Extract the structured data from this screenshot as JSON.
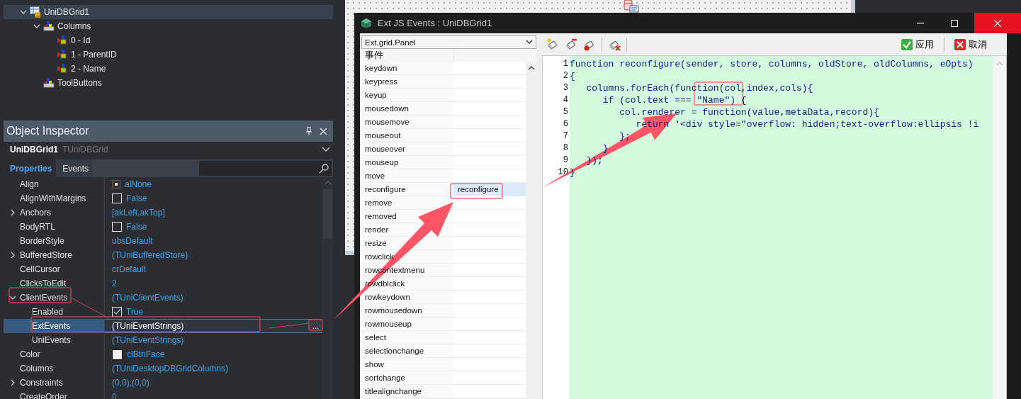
{
  "tree": [
    {
      "label": "UniDBGrid1",
      "kind": "grid",
      "selected": true,
      "expanded": true,
      "children": [
        {
          "label": "Columns",
          "kind": "collection",
          "selected": false,
          "expanded": true,
          "children": [
            {
              "label": "0 - Id",
              "kind": "column",
              "selected": false
            },
            {
              "label": "1 - ParentID",
              "kind": "column",
              "selected": false
            },
            {
              "label": "2 - Name",
              "kind": "column",
              "selected": false
            }
          ]
        },
        {
          "label": "ToolButtons",
          "kind": "collection",
          "selected": false
        }
      ]
    }
  ],
  "inspector": {
    "title": "Object Inspector",
    "component": {
      "name": "UniDBGrid1",
      "type": "TUniDBGrid"
    },
    "tabs": [
      {
        "label": "Properties",
        "selected": true
      },
      {
        "label": "Events",
        "selected": false
      }
    ],
    "properties": [
      {
        "name": "Align",
        "value": "alNone",
        "kind": "align",
        "selected": false
      },
      {
        "name": "AlignWithMargins",
        "value": "False",
        "kind": "checkbox",
        "checked": false,
        "selected": false
      },
      {
        "name": "Anchors",
        "value": "[akLeft,akTop]",
        "kind": "text",
        "expanded": false,
        "selected": false
      },
      {
        "name": "BodyRTL",
        "value": "False",
        "kind": "checkbox",
        "checked": false,
        "selected": false
      },
      {
        "name": "BorderStyle",
        "value": "ubsDefault",
        "kind": "text",
        "selected": false
      },
      {
        "name": "BufferedStore",
        "value": "(TUniBufferedStore)",
        "kind": "text",
        "expanded": false,
        "selected": false
      },
      {
        "name": "CellCursor",
        "value": "crDefault",
        "kind": "text",
        "selected": false
      },
      {
        "name": "ClicksToEdit",
        "value": "2",
        "kind": "text",
        "selected": false
      },
      {
        "name": "ClientEvents",
        "value": "(TUniClientEvents)",
        "kind": "text",
        "expanded": true,
        "selected": false,
        "children": [
          {
            "name": "Enabled",
            "value": "True",
            "kind": "checkbox",
            "checked": true,
            "selected": false
          },
          {
            "name": "ExtEvents",
            "value": "(TUniEventStrings)",
            "kind": "text",
            "button": "...",
            "selected": true
          },
          {
            "name": "UniEvents",
            "value": "(TUniEventStrings)",
            "kind": "text",
            "selected": false
          }
        ]
      },
      {
        "name": "Color",
        "value": "clBtnFace",
        "kind": "color",
        "selected": false
      },
      {
        "name": "Columns",
        "value": "(TUniDesktopDBGridColumns)",
        "kind": "text",
        "selected": false
      },
      {
        "name": "Constraints",
        "value": "(0,0),(0,0)",
        "kind": "text",
        "expanded": false,
        "selected": false
      },
      {
        "name": "CreateOrder",
        "value": "0",
        "kind": "text",
        "selected": false
      }
    ]
  },
  "dialog": {
    "title": "Ext JS Events : UniDBGrid1",
    "class_select": "Ext.grid.Panel",
    "events_header": "事件",
    "events": [
      {
        "name": "keydown",
        "selected": false
      },
      {
        "name": "keypress",
        "selected": false
      },
      {
        "name": "keyup",
        "selected": false
      },
      {
        "name": "mousedown",
        "selected": false
      },
      {
        "name": "mousemove",
        "selected": false
      },
      {
        "name": "mouseout",
        "selected": false
      },
      {
        "name": "mouseover",
        "selected": false
      },
      {
        "name": "mouseup",
        "selected": false
      },
      {
        "name": "move",
        "selected": false
      },
      {
        "name": "reconfigure",
        "handler": "reconfigure",
        "selected": true
      },
      {
        "name": "remove",
        "selected": false
      },
      {
        "name": "removed",
        "selected": false
      },
      {
        "name": "render",
        "selected": false
      },
      {
        "name": "resize",
        "selected": false
      },
      {
        "name": "rowclick",
        "selected": false
      },
      {
        "name": "rowcontextmenu",
        "selected": false
      },
      {
        "name": "rowdblclick",
        "selected": false
      },
      {
        "name": "rowkeydown",
        "selected": false
      },
      {
        "name": "rowmousedown",
        "selected": false
      },
      {
        "name": "rowmouseup",
        "selected": false
      },
      {
        "name": "select",
        "selected": false
      },
      {
        "name": "selectionchange",
        "selected": false
      },
      {
        "name": "show",
        "selected": false
      },
      {
        "name": "sortchange",
        "selected": false
      },
      {
        "name": "titlealignchange",
        "selected": false
      }
    ],
    "actions": [
      {
        "label": "应用",
        "kind": "apply"
      },
      {
        "label": "取消",
        "kind": "cancel"
      }
    ],
    "code_lines": [
      {
        "number": "1",
        "text": "function reconfigure(sender, store, columns, oldStore, oldColumns, eOpts)"
      },
      {
        "number": "2",
        "text": "{"
      },
      {
        "number": "3",
        "text": "   columns.forEach(function(col,index,cols){"
      },
      {
        "number": "4",
        "text": "      if (col.text === \"Name\") {"
      },
      {
        "number": "5",
        "text": "         col.renderer = function(value,metaData,record){"
      },
      {
        "number": "6",
        "text": "            return '<div style=\"overflow: hidden;text-overflow:ellipsis !i"
      },
      {
        "number": "7",
        "text": "         };"
      },
      {
        "number": "8",
        "text": "      }"
      },
      {
        "number": "9",
        "text": "   });"
      },
      {
        "number": "10",
        "text": "}"
      }
    ]
  }
}
